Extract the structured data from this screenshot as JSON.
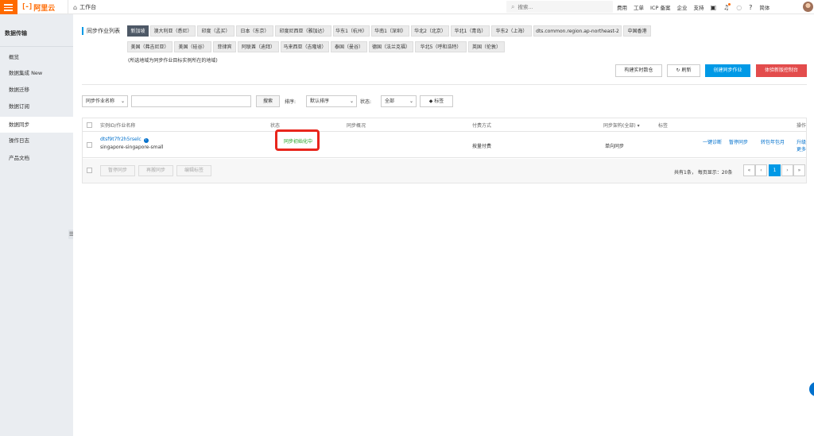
{
  "topbar": {
    "logo_mark": "[-]",
    "logo_text": "阿里云",
    "workbench": "工作台",
    "search_placeholder": "搜索...",
    "nav": [
      "费用",
      "工单",
      "ICP 备案",
      "企业",
      "支持"
    ],
    "lang": "简体"
  },
  "sidebar": {
    "title": "数据传输",
    "items": [
      {
        "label": "概览"
      },
      {
        "label": "数据集成 New"
      },
      {
        "label": "数据迁移"
      },
      {
        "label": "数据订阅"
      },
      {
        "label": "数据同步"
      },
      {
        "label": "操作日志"
      },
      {
        "label": "产品文档"
      }
    ],
    "active_index": 4
  },
  "main": {
    "region_title": "同步作业列表",
    "regions_row1": [
      "新加坡",
      "澳大利亚（悉尼）",
      "印度（孟买）",
      "日本（东京）",
      "印度尼西亚（雅加达）",
      "华东1（杭州）",
      "华南1（深圳）",
      "华北2（北京）",
      "华北1（青岛）",
      "华东2（上海）",
      "dts.common.region.ap-northeast-2",
      "中国香港"
    ],
    "regions_row2": [
      "美国（弗吉尼亚）",
      "美国（硅谷）",
      "菲律宾",
      "阿联酋（迪拜）",
      "马来西亚（吉隆坡）",
      "泰国（曼谷）",
      "德国（法兰克福）",
      "华北5（呼和浩特）",
      "英国（伦敦）"
    ],
    "selected_region": "新加坡",
    "region_note": "(所选地域为同步作业目标实例所在的地域)",
    "buttons": {
      "build": "构建实时数仓",
      "refresh": "刷新",
      "create": "创建同步作业",
      "new_console": "体验新版控制台"
    },
    "filter": {
      "field_select": "同步作业名称",
      "search_button": "搜索",
      "sort_label": "排序:",
      "sort_value": "默认排序",
      "status_label": "状态:",
      "status_value": "全部",
      "tag_button": "标签"
    },
    "table": {
      "headers": {
        "instance": "实例ID/作业名称",
        "status": "状态",
        "overview": "同步概况",
        "billing": "付费方式",
        "arch": "同步架构(全部)",
        "tag": "标签",
        "ops": "操作"
      },
      "row": {
        "id": "dtsf9t7fr2h5rselc",
        "name": "singapore-singapore-small",
        "status": "同步初始化中",
        "billing": "按量付费",
        "arch": "单向同步",
        "ops": [
          "一键诊断",
          "暂停同步",
          "转包年包月",
          "升级",
          "更多"
        ]
      },
      "footer": {
        "pause": "暂停同步",
        "resync": "再搬同步",
        "edit_tag": "编辑标签",
        "pager_info": "共有1条， 每页显示：20条",
        "current_page": "1"
      }
    }
  }
}
